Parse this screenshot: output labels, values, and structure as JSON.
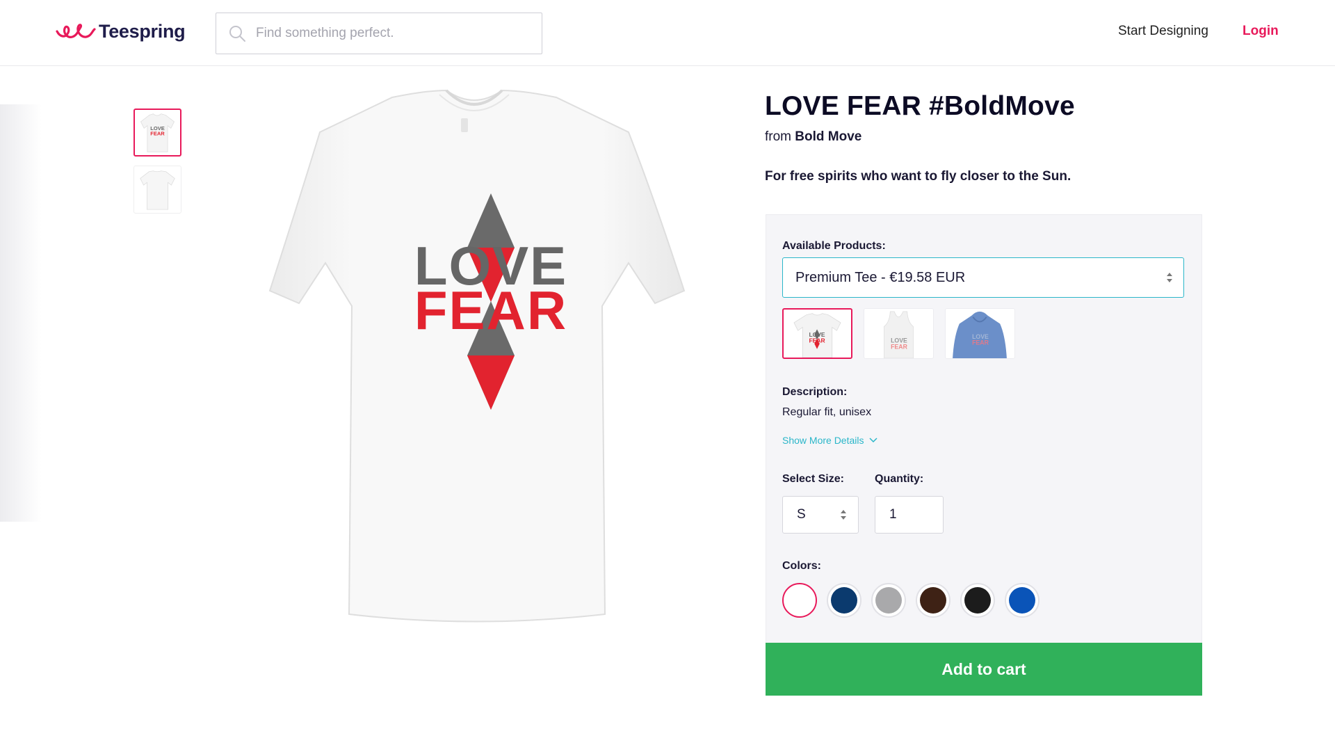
{
  "header": {
    "logo_text": "Teespring",
    "search_placeholder": "Find something perfect.",
    "start_designing": "Start Designing",
    "login": "Login"
  },
  "product": {
    "title": "LOVE FEAR #BoldMove",
    "from_prefix": "from",
    "store_name": "Bold Move",
    "tagline": "For free spirits who want to fly closer to the Sun.",
    "design_text_line1": "LOVE",
    "design_text_line2": "FEAR"
  },
  "options": {
    "available_products_label": "Available Products:",
    "selected_product": "Premium Tee - €19.58 EUR",
    "variants": [
      "premium-tee",
      "tank-top",
      "hoodie"
    ],
    "description_label": "Description:",
    "description_text": "Regular fit, unisex",
    "show_more": "Show More Details",
    "size_label": "Select Size:",
    "selected_size": "S",
    "quantity_label": "Quantity:",
    "quantity": "1",
    "colors_label": "Colors:",
    "colors": [
      {
        "name": "white",
        "hex": "#ffffff",
        "selected": true
      },
      {
        "name": "navy",
        "hex": "#0b3a6e"
      },
      {
        "name": "grey",
        "hex": "#a9a9ab"
      },
      {
        "name": "brown",
        "hex": "#3e2215"
      },
      {
        "name": "black",
        "hex": "#1c1c1c"
      },
      {
        "name": "royal-blue",
        "hex": "#0a54b8"
      }
    ],
    "add_to_cart": "Add to cart"
  },
  "theme": {
    "accent": "#e8195a",
    "link": "#2ab6c9",
    "cta": "#30b15a"
  }
}
